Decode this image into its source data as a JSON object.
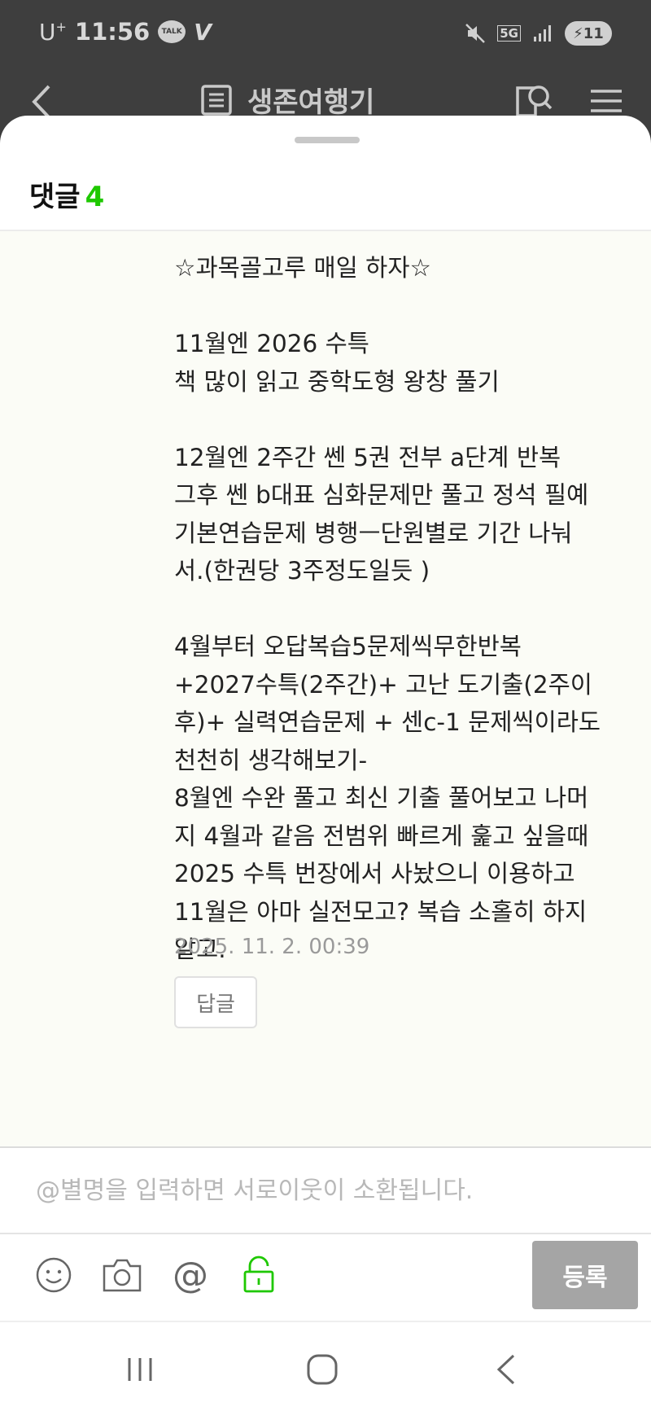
{
  "status_bar": {
    "carrier": "U",
    "carrier_sup": "+",
    "time": "11:56",
    "talk_label": "TALK",
    "v_label": "V",
    "network": "5G",
    "battery": "11"
  },
  "header": {
    "title": "생존여행기"
  },
  "sheet": {
    "title": "댓글",
    "count": "4"
  },
  "comment": {
    "lines": [
      "☆과목골고루 매일 하자☆",
      "",
      "11월엔 2026 수특",
      "책 많이 읽고 중학도형 왕창 풀기",
      "",
      "12월엔 2주간 쎈 5권 전부 a단계 반복",
      "그후 쎈 b대표 심화문제만 풀고 정석 필예",
      "기본연습문제 병행ㅡ단원별로 기간 나눠",
      "서.(한권당 3주정도일듯 )",
      "",
      "4월부터 오답복습5문제씩무한반복",
      "+2027수특(2주간)+ 고난 도기출(2주이",
      "후)+ 실력연습문제 + 센c-1 문제씩이라도",
      "천천히 생각해보기-",
      "8월엔 수완 풀고 최신 기출 풀어보고 나머",
      "지 4월과 같음 전범위 빠르게 훑고 싶을때",
      "2025 수특 번장에서 사놨으니 이용하고",
      "11월은 아마 실전모고? 복습 소홀히 하지",
      "알고."
    ],
    "date": "2025. 11. 2. 00:39",
    "reply_label": "답글"
  },
  "input": {
    "placeholder": "@별명을 입력하면 서로이웃이 소환됩니다.",
    "value": ""
  },
  "toolbar": {
    "at_label": "@",
    "submit_label": "등록",
    "accent": "#1ec800"
  }
}
